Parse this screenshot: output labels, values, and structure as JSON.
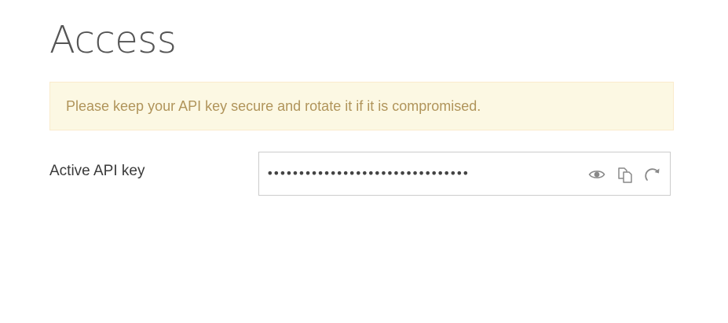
{
  "page": {
    "title": "Access"
  },
  "alert": {
    "message": "Please keep your API key secure and rotate it if it is compromised."
  },
  "api_key": {
    "label": "Active API key",
    "masked_value": "••••••••••••••••••••••••••••••••",
    "actions": {
      "reveal_icon": "eye-icon",
      "copy_icon": "copy-icon",
      "rotate_icon": "rotate-icon"
    }
  },
  "colors": {
    "alert_background": "#fcf8e3",
    "alert_border": "#faebcc",
    "alert_text": "#b0945a",
    "icon": "#888888",
    "field_border": "#cccccc"
  }
}
